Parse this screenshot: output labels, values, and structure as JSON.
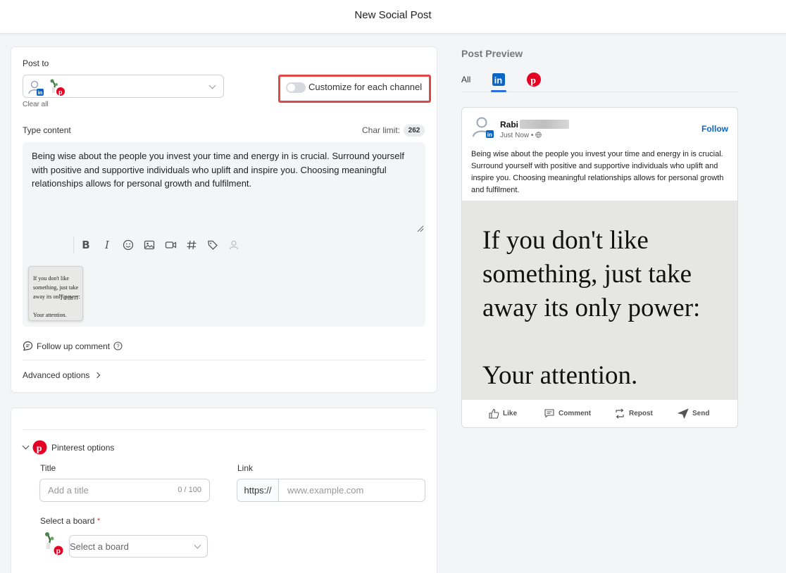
{
  "header": {
    "title": "New Social Post"
  },
  "post_to": {
    "label": "Post to",
    "clear_all": "Clear all",
    "customize_label": "Customize for each channel",
    "customize_enabled": false
  },
  "content": {
    "label": "Type content",
    "char_limit_label": "Char limit:",
    "char_limit_value": "262",
    "text": "Being wise about the people you invest your time and energy in is crucial. Surround yourself with positive and supportive individuals who uplift and inspire you. Choosing meaningful relationships allows for personal growth and fulfilment.",
    "toolbar": [
      "bold-icon",
      "italic-icon",
      "emoji-icon",
      "image-icon",
      "video-icon",
      "hashtag-icon",
      "tag-icon",
      "mention-icon"
    ],
    "thumb_lines": [
      "If you don't like",
      "something, just take",
      "away its only power:",
      "Your attention."
    ],
    "thumb_overlay": "Team"
  },
  "follow_up": {
    "label": "Follow up comment"
  },
  "advanced": {
    "label": "Advanced options"
  },
  "pinterest": {
    "section_label": "Pinterest options",
    "title_label": "Title",
    "title_placeholder": "Add a title",
    "title_counter": "0 / 100",
    "link_label": "Link",
    "link_prefix": "https://",
    "link_placeholder": "www.example.com",
    "board_label": "Select a board",
    "board_required": "*",
    "board_placeholder": "Select a board"
  },
  "preview": {
    "title": "Post Preview",
    "tabs": {
      "all": "All",
      "active": "linkedin"
    },
    "card": {
      "name": "Rabi",
      "time": "Just Now •",
      "follow": "Follow",
      "text": "Being wise about the people you invest your time and energy in is crucial. Surround yourself with positive and supportive individuals who uplift and inspire you. Choosing meaningful relationships allows for personal growth and fulfilment.",
      "quote_lines": [
        "If you don't like",
        "something, just take",
        "away its only power:",
        "Your attention."
      ],
      "actions": {
        "like": "Like",
        "comment": "Comment",
        "repost": "Repost",
        "send": "Send"
      }
    }
  },
  "colors": {
    "linkedin": "#0a66c2",
    "pinterest": "#e60023",
    "highlight": "#e04848"
  }
}
